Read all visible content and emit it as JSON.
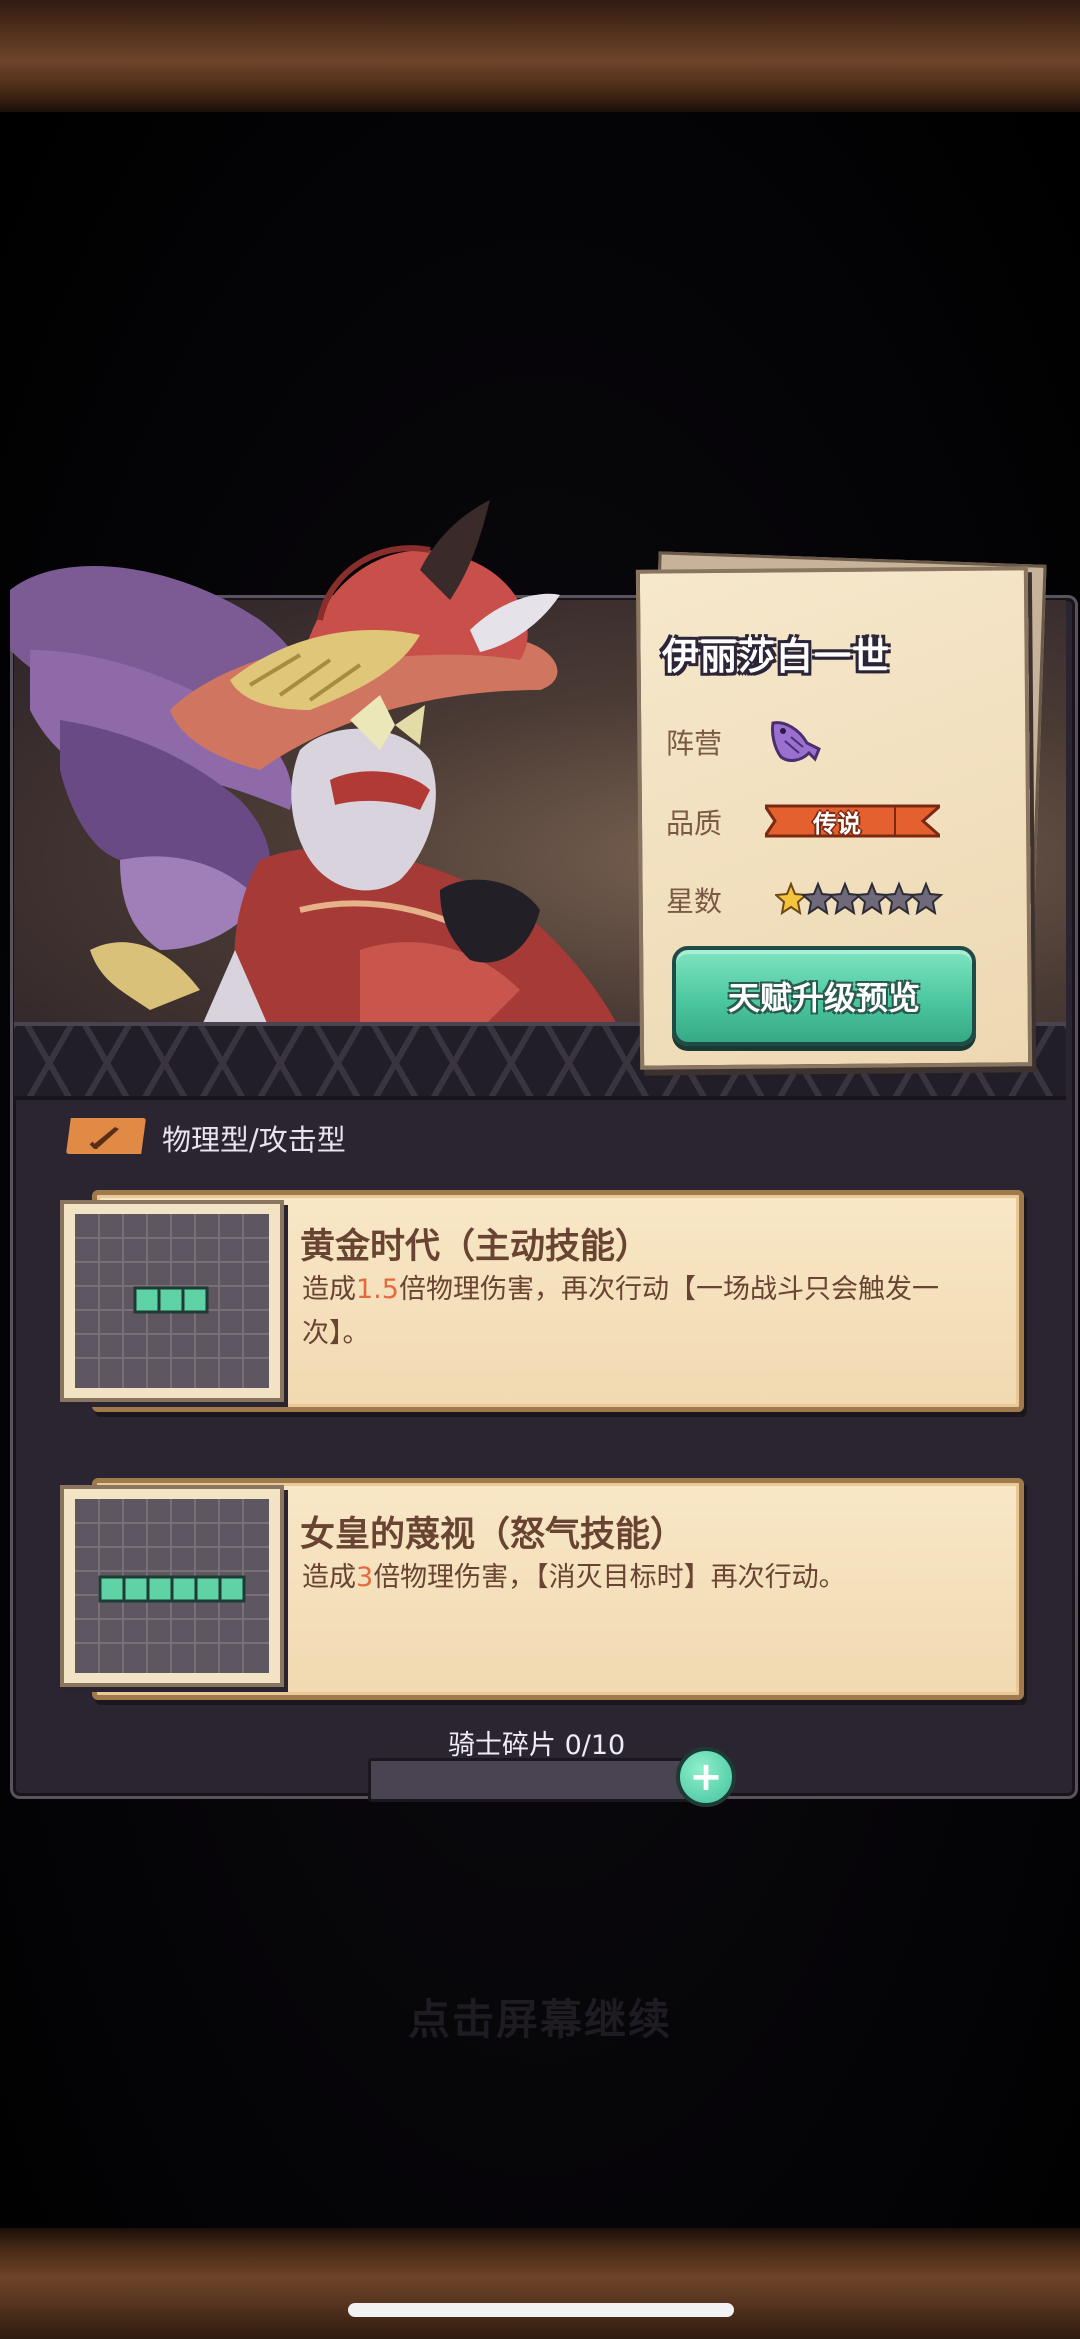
{
  "hero": {
    "name": "伊丽莎白一世",
    "camp_label": "阵营",
    "camp_icon": "purple-fish-icon",
    "quality_label": "品质",
    "quality_value": "传说",
    "stars_label": "星数",
    "stars_filled": 1,
    "stars_total": 6,
    "talent_button": "天赋升级预览"
  },
  "type_label": "物理型/攻击型",
  "skills": [
    {
      "title": "黄金时代（主动技能）",
      "desc_before": "造成",
      "desc_highlight": "1.5",
      "desc_after": "倍物理伤害，再次行动【一场战斗只会触发一次】。",
      "grid_cells": 3
    },
    {
      "title": "女皇的蔑视（怒气技能）",
      "desc_before": "造成",
      "desc_highlight": "3",
      "desc_after": "倍物理伤害，【消灭目标时】再次行动。",
      "grid_cells": 6
    }
  ],
  "shards": {
    "label": "骑士碎片 0/10",
    "current": 0,
    "total": 10
  },
  "continue_text": "点击屏幕继续",
  "colors": {
    "accent_green": "#4cc79f",
    "highlight_orange": "#e26b3e",
    "card_text": "#6a4432",
    "quality_ribbon": "#e4602f"
  }
}
